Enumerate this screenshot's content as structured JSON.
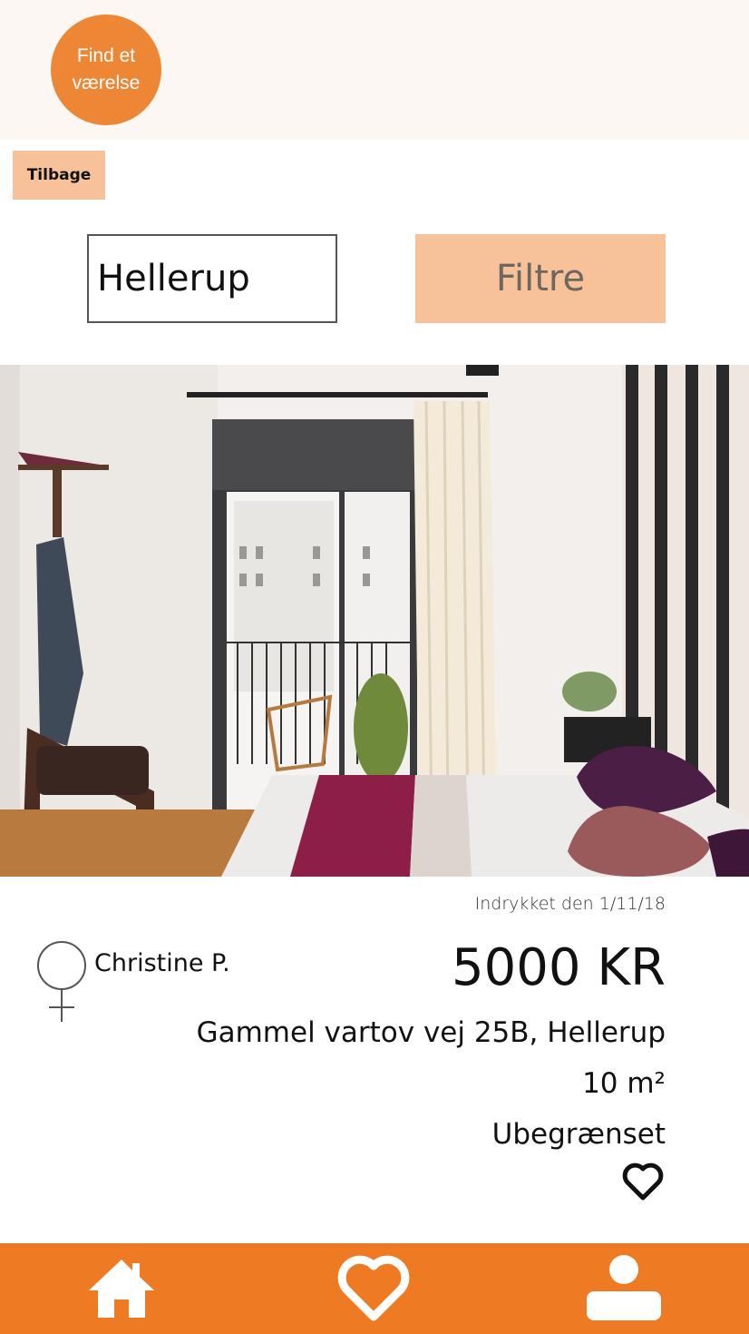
{
  "header": {
    "app_title": "Find et\nværelse"
  },
  "toolbar": {
    "back_label": "Tilbage"
  },
  "search": {
    "value": "Hellerup",
    "placeholder": ""
  },
  "filter": {
    "label": "Filtre"
  },
  "listing": {
    "posted": "Indrykket den 1/11/18",
    "owner_name": "Christine P.",
    "owner_gender_icon": "female-symbol-icon",
    "price": "5000 KR",
    "address": "Gammel vartov vej 25B, Hellerup",
    "size": "10 m²",
    "period": "Ubegrænset",
    "favorite_icon": "heart-outline-icon"
  },
  "nav": {
    "items": [
      {
        "icon": "home-icon"
      },
      {
        "icon": "heart-icon"
      },
      {
        "icon": "user-icon"
      }
    ]
  },
  "colors": {
    "brand_orange": "#ee7a24",
    "light_orange": "#f7c29a",
    "header_bg": "#fcf7f3"
  }
}
